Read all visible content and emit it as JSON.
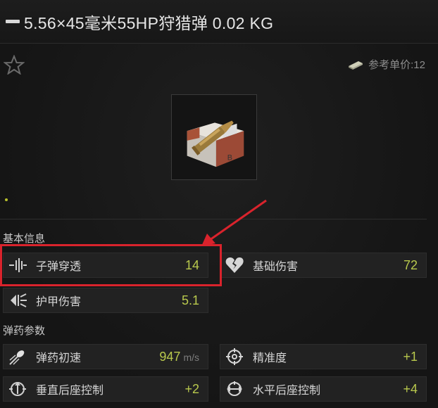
{
  "header": {
    "title": "5.56×45毫米55HP狩猎弹 0.02 KG"
  },
  "price": {
    "label": "参考单价:12",
    "icon": "money-stack-icon"
  },
  "favorite": {
    "icon": "star-outline-icon"
  },
  "item_image": {
    "icon": "ammo-box-with-cartridge-icon"
  },
  "sections": {
    "basic": "基本信息",
    "ammo": "弹药参数"
  },
  "stats": {
    "penetration": {
      "label": "子弹穿透",
      "value": "14",
      "icon": "penetration-icon"
    },
    "base_damage": {
      "label": "基础伤害",
      "value": "72",
      "icon": "broken-heart-icon"
    },
    "armor_damage": {
      "label": "护甲伤害",
      "value": "5.1",
      "icon": "armor-damage-icon"
    },
    "velocity": {
      "label": "弹药初速",
      "value": "947",
      "unit": "m/s",
      "icon": "velocity-icon"
    },
    "accuracy": {
      "label": "精准度",
      "value": "+1",
      "icon": "crosshair-icon"
    },
    "vertical_recoil": {
      "label": "垂直后座控制",
      "value": "+2",
      "icon": "vertical-recoil-icon"
    },
    "horizontal_recoil": {
      "label": "水平后座控制",
      "value": "+4",
      "icon": "horizontal-recoil-icon"
    }
  },
  "colors": {
    "background": "#161616",
    "value_green": "#b9c94d",
    "highlight_red": "#d9232c"
  }
}
